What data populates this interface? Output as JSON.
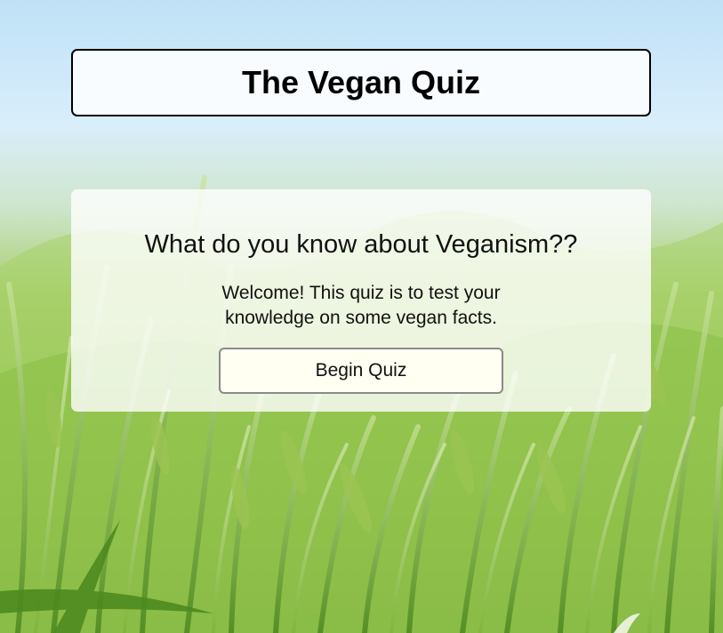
{
  "header": {
    "title": "The Vegan Quiz"
  },
  "intro": {
    "heading": "What do you know about Veganism??",
    "description": "Welcome! This quiz is to test your knowledge on some vegan facts.",
    "start_button_label": "Begin Quiz"
  },
  "colors": {
    "sky": "#bfe1f7",
    "field_green": "#8fc24a",
    "button_bg": "#fffff2"
  }
}
